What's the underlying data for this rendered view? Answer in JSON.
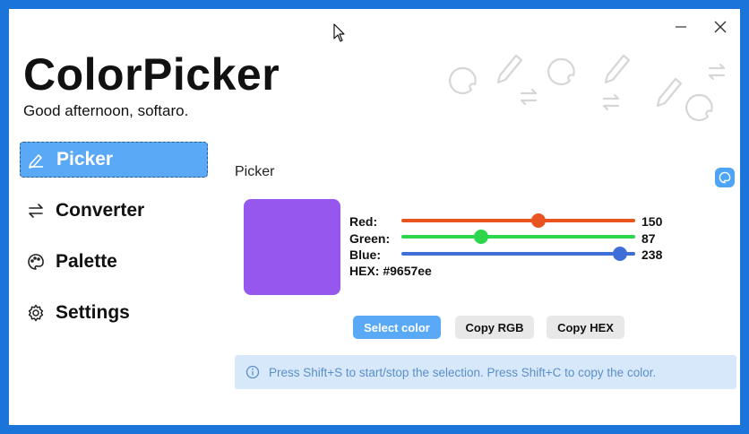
{
  "app": {
    "title": "ColorPicker",
    "greeting": "Good afternoon, softaro."
  },
  "window_controls": {
    "minimize_icon": "minimize-icon",
    "close_icon": "close-icon"
  },
  "sidebar": {
    "items": [
      {
        "label": "Picker",
        "icon": "pencil-icon",
        "active": true
      },
      {
        "label": "Converter",
        "icon": "swap-arrows-icon",
        "active": false
      },
      {
        "label": "Palette",
        "icon": "palette-icon",
        "active": false
      },
      {
        "label": "Settings",
        "icon": "gear-icon",
        "active": false
      }
    ]
  },
  "main": {
    "section_title": "Picker",
    "selected_color": "#9657ee",
    "channels": [
      {
        "label": "Red:",
        "value": "150",
        "color": "#e8531f",
        "fraction": 0.588
      },
      {
        "label": "Green:",
        "value": "87",
        "color": "#2dd64a",
        "fraction": 0.341
      },
      {
        "label": "Blue:",
        "value": "238",
        "color": "#3f6ed9",
        "fraction": 0.933
      }
    ],
    "hex_text": "HEX: #9657ee",
    "buttons": {
      "select": "Select color",
      "copy_rgb": "Copy RGB",
      "copy_hex": "Copy HEX"
    },
    "info": "Press Shift+S to start/stop the selection. Press Shift+C to copy the color."
  },
  "colors": {
    "accent": "#5aa9f6",
    "window_border": "#1a74d9",
    "info_bg": "#d7e8fb",
    "info_text": "#5a8fc8"
  }
}
